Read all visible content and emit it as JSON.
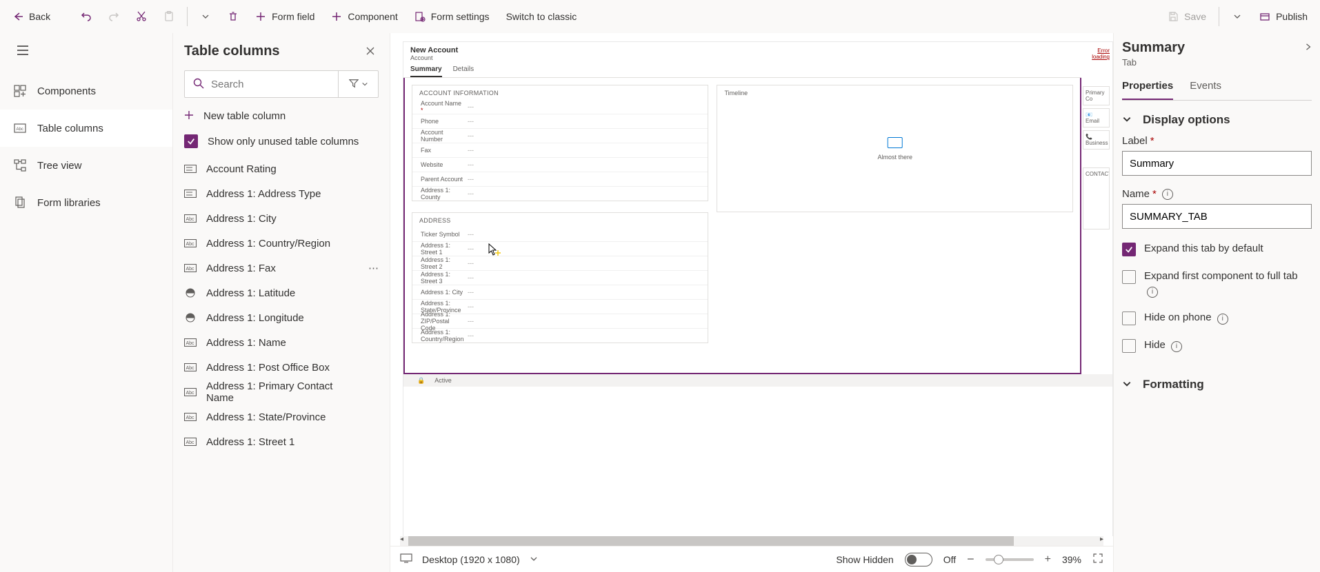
{
  "cmdbar": {
    "back": "Back",
    "formfield": "Form field",
    "component": "Component",
    "formsettings": "Form settings",
    "switch": "Switch to classic",
    "save": "Save",
    "publish": "Publish"
  },
  "leftnav": {
    "components": "Components",
    "tablecolumns": "Table columns",
    "treeview": "Tree view",
    "formlibraries": "Form libraries"
  },
  "tcol": {
    "title": "Table columns",
    "search_ph": "Search",
    "newcol": "New table column",
    "onlyunused": "Show only unused table columns",
    "items": [
      {
        "type": "opt",
        "label": "Account Rating"
      },
      {
        "type": "opt",
        "label": "Address 1: Address Type"
      },
      {
        "type": "abc",
        "label": "Address 1: City"
      },
      {
        "type": "abc",
        "label": "Address 1: Country/Region"
      },
      {
        "type": "abc",
        "label": "Address 1: Fax",
        "hover": true
      },
      {
        "type": "globe",
        "label": "Address 1: Latitude"
      },
      {
        "type": "globe",
        "label": "Address 1: Longitude"
      },
      {
        "type": "abc",
        "label": "Address 1: Name"
      },
      {
        "type": "abc",
        "label": "Address 1: Post Office Box"
      },
      {
        "type": "abc",
        "label": "Address 1: Primary Contact Name"
      },
      {
        "type": "abc",
        "label": "Address 1: State/Province"
      },
      {
        "type": "abc",
        "label": "Address 1: Street 1"
      }
    ]
  },
  "formcanvas": {
    "title": "New Account",
    "subtitle": "Account",
    "tabs": [
      "Summary",
      "Details"
    ],
    "sec1_title": "ACCOUNT INFORMATION",
    "sec1": [
      {
        "l": "Account Name",
        "req": true
      },
      {
        "l": "Phone"
      },
      {
        "l": "Account Number"
      },
      {
        "l": "Fax"
      },
      {
        "l": "Website"
      },
      {
        "l": "Parent Account"
      },
      {
        "l": "Address 1: County"
      }
    ],
    "sec2_title": "ADDRESS",
    "sec2": [
      {
        "l": "Ticker Symbol"
      },
      {
        "l": "Address 1: Street 1"
      },
      {
        "l": "Address 1: Street 2"
      },
      {
        "l": "Address 1: Street 3"
      },
      {
        "l": "Address 1: City"
      },
      {
        "l": "Address 1: State/Province"
      },
      {
        "l": "Address 1: ZIP/Postal Code"
      },
      {
        "l": "Address 1: Country/Region"
      }
    ],
    "timeline_label": "Timeline",
    "almost_there": "Almost there",
    "error_loading": "Error loading",
    "primary_contact": "Primary Co",
    "email": "Email",
    "business": "Business",
    "contacts": "CONTACTS",
    "footer_active": "Active"
  },
  "status": {
    "viewport": "Desktop (1920 x 1080)",
    "showhidden": "Show Hidden",
    "toggle": "Off",
    "zoom": "39%"
  },
  "prop": {
    "title": "Summary",
    "subtitle": "Tab",
    "tab_properties": "Properties",
    "tab_events": "Events",
    "disp_options": "Display options",
    "label_label": "Label",
    "label_value": "Summary",
    "name_label": "Name",
    "name_value": "SUMMARY_TAB",
    "expand_default": "Expand this tab by default",
    "expand_first": "Expand first component to full tab",
    "hide_phone": "Hide on phone",
    "hide": "Hide",
    "formatting": "Formatting"
  }
}
